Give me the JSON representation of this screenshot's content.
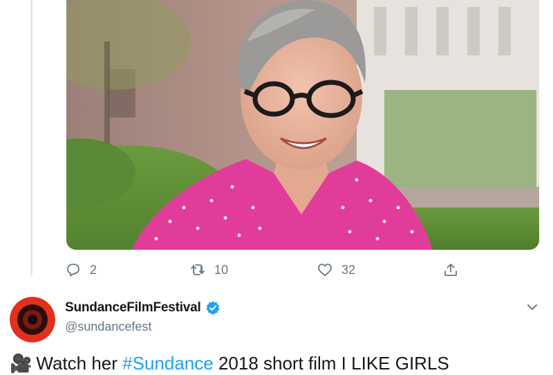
{
  "tweet_actions": {
    "reply_count": "2",
    "retweet_count": "10",
    "like_count": "32"
  },
  "next_tweet": {
    "display_name": "SundanceFilmFestival",
    "handle": "@sundancefest",
    "text_emoji": "🎥",
    "text_before_hashtag": "Watch her",
    "hashtag": "#Sundance",
    "text_after_hashtag": "2018 short film I LIKE GIRLS"
  },
  "colors": {
    "accent": "#1da1f2",
    "muted": "#657786",
    "avatar_red": "#e0311f"
  }
}
